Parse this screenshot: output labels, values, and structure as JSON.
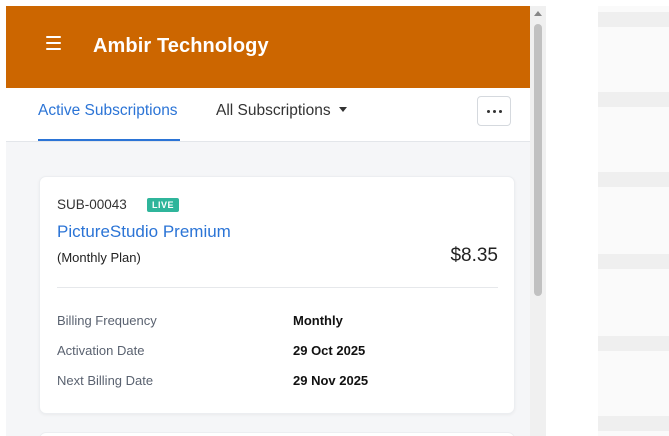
{
  "header": {
    "title": "Ambir Technology"
  },
  "tabs": {
    "active_label": "Active Subscriptions",
    "all_label": "All Subscriptions"
  },
  "subscription": {
    "id": "SUB-00043",
    "status": "LIVE",
    "plan_name": "PictureStudio Premium",
    "plan_cycle": "(Monthly Plan)",
    "price": "$8.35",
    "details": [
      {
        "label": "Billing Frequency",
        "value": "Monthly"
      },
      {
        "label": "Activation Date",
        "value": "29 Oct 2025"
      },
      {
        "label": "Next Billing Date",
        "value": "29 Nov 2025"
      }
    ]
  },
  "colors": {
    "header_bg": "#cc6600",
    "accent": "#2b74d6",
    "live_badge": "#2fb59b"
  }
}
